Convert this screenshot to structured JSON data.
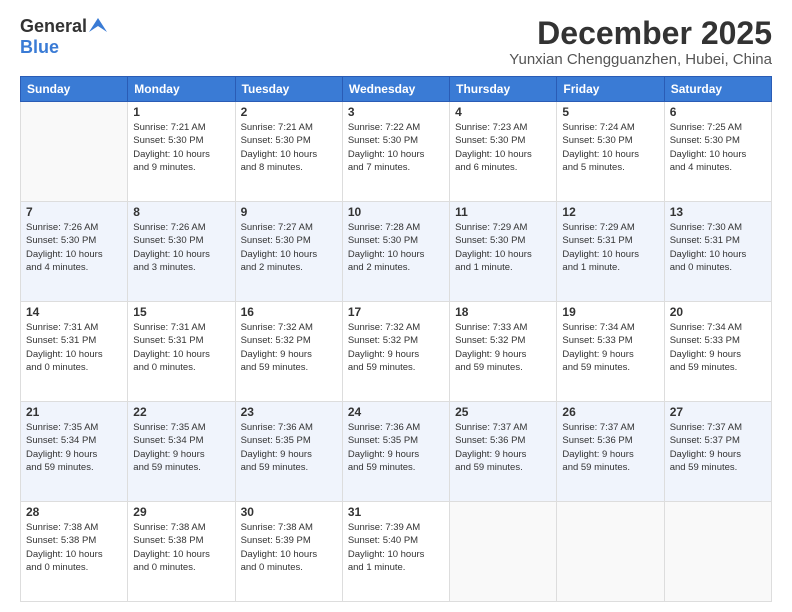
{
  "header": {
    "logo_general": "General",
    "logo_blue": "Blue",
    "month_title": "December 2025",
    "location": "Yunxian Chengguanzhen, Hubei, China"
  },
  "days_of_week": [
    "Sunday",
    "Monday",
    "Tuesday",
    "Wednesday",
    "Thursday",
    "Friday",
    "Saturday"
  ],
  "weeks": [
    [
      {
        "day": "",
        "info": ""
      },
      {
        "day": "1",
        "info": "Sunrise: 7:21 AM\nSunset: 5:30 PM\nDaylight: 10 hours\nand 9 minutes."
      },
      {
        "day": "2",
        "info": "Sunrise: 7:21 AM\nSunset: 5:30 PM\nDaylight: 10 hours\nand 8 minutes."
      },
      {
        "day": "3",
        "info": "Sunrise: 7:22 AM\nSunset: 5:30 PM\nDaylight: 10 hours\nand 7 minutes."
      },
      {
        "day": "4",
        "info": "Sunrise: 7:23 AM\nSunset: 5:30 PM\nDaylight: 10 hours\nand 6 minutes."
      },
      {
        "day": "5",
        "info": "Sunrise: 7:24 AM\nSunset: 5:30 PM\nDaylight: 10 hours\nand 5 minutes."
      },
      {
        "day": "6",
        "info": "Sunrise: 7:25 AM\nSunset: 5:30 PM\nDaylight: 10 hours\nand 4 minutes."
      }
    ],
    [
      {
        "day": "7",
        "info": "Sunrise: 7:26 AM\nSunset: 5:30 PM\nDaylight: 10 hours\nand 4 minutes."
      },
      {
        "day": "8",
        "info": "Sunrise: 7:26 AM\nSunset: 5:30 PM\nDaylight: 10 hours\nand 3 minutes."
      },
      {
        "day": "9",
        "info": "Sunrise: 7:27 AM\nSunset: 5:30 PM\nDaylight: 10 hours\nand 2 minutes."
      },
      {
        "day": "10",
        "info": "Sunrise: 7:28 AM\nSunset: 5:30 PM\nDaylight: 10 hours\nand 2 minutes."
      },
      {
        "day": "11",
        "info": "Sunrise: 7:29 AM\nSunset: 5:30 PM\nDaylight: 10 hours\nand 1 minute."
      },
      {
        "day": "12",
        "info": "Sunrise: 7:29 AM\nSunset: 5:31 PM\nDaylight: 10 hours\nand 1 minute."
      },
      {
        "day": "13",
        "info": "Sunrise: 7:30 AM\nSunset: 5:31 PM\nDaylight: 10 hours\nand 0 minutes."
      }
    ],
    [
      {
        "day": "14",
        "info": "Sunrise: 7:31 AM\nSunset: 5:31 PM\nDaylight: 10 hours\nand 0 minutes."
      },
      {
        "day": "15",
        "info": "Sunrise: 7:31 AM\nSunset: 5:31 PM\nDaylight: 10 hours\nand 0 minutes."
      },
      {
        "day": "16",
        "info": "Sunrise: 7:32 AM\nSunset: 5:32 PM\nDaylight: 9 hours\nand 59 minutes."
      },
      {
        "day": "17",
        "info": "Sunrise: 7:32 AM\nSunset: 5:32 PM\nDaylight: 9 hours\nand 59 minutes."
      },
      {
        "day": "18",
        "info": "Sunrise: 7:33 AM\nSunset: 5:32 PM\nDaylight: 9 hours\nand 59 minutes."
      },
      {
        "day": "19",
        "info": "Sunrise: 7:34 AM\nSunset: 5:33 PM\nDaylight: 9 hours\nand 59 minutes."
      },
      {
        "day": "20",
        "info": "Sunrise: 7:34 AM\nSunset: 5:33 PM\nDaylight: 9 hours\nand 59 minutes."
      }
    ],
    [
      {
        "day": "21",
        "info": "Sunrise: 7:35 AM\nSunset: 5:34 PM\nDaylight: 9 hours\nand 59 minutes."
      },
      {
        "day": "22",
        "info": "Sunrise: 7:35 AM\nSunset: 5:34 PM\nDaylight: 9 hours\nand 59 minutes."
      },
      {
        "day": "23",
        "info": "Sunrise: 7:36 AM\nSunset: 5:35 PM\nDaylight: 9 hours\nand 59 minutes."
      },
      {
        "day": "24",
        "info": "Sunrise: 7:36 AM\nSunset: 5:35 PM\nDaylight: 9 hours\nand 59 minutes."
      },
      {
        "day": "25",
        "info": "Sunrise: 7:37 AM\nSunset: 5:36 PM\nDaylight: 9 hours\nand 59 minutes."
      },
      {
        "day": "26",
        "info": "Sunrise: 7:37 AM\nSunset: 5:36 PM\nDaylight: 9 hours\nand 59 minutes."
      },
      {
        "day": "27",
        "info": "Sunrise: 7:37 AM\nSunset: 5:37 PM\nDaylight: 9 hours\nand 59 minutes."
      }
    ],
    [
      {
        "day": "28",
        "info": "Sunrise: 7:38 AM\nSunset: 5:38 PM\nDaylight: 10 hours\nand 0 minutes."
      },
      {
        "day": "29",
        "info": "Sunrise: 7:38 AM\nSunset: 5:38 PM\nDaylight: 10 hours\nand 0 minutes."
      },
      {
        "day": "30",
        "info": "Sunrise: 7:38 AM\nSunset: 5:39 PM\nDaylight: 10 hours\nand 0 minutes."
      },
      {
        "day": "31",
        "info": "Sunrise: 7:39 AM\nSunset: 5:40 PM\nDaylight: 10 hours\nand 1 minute."
      },
      {
        "day": "",
        "info": ""
      },
      {
        "day": "",
        "info": ""
      },
      {
        "day": "",
        "info": ""
      }
    ]
  ]
}
